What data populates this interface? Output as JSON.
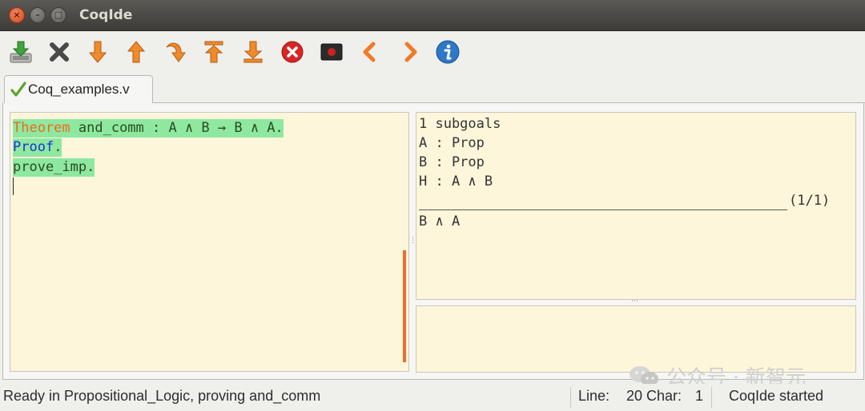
{
  "window": {
    "title": "CoqIde"
  },
  "toolbar": {
    "buttons": [
      {
        "icon": "save-icon",
        "tooltip": ""
      },
      {
        "icon": "close-icon",
        "tooltip": ""
      },
      {
        "icon": "arrow-down-icon",
        "tooltip": ""
      },
      {
        "icon": "arrow-up-icon",
        "tooltip": ""
      },
      {
        "icon": "goto-cursor-icon",
        "tooltip": ""
      },
      {
        "icon": "go-top-icon",
        "tooltip": ""
      },
      {
        "icon": "go-bottom-icon",
        "tooltip": ""
      },
      {
        "icon": "stop-icon",
        "tooltip": ""
      },
      {
        "icon": "terminal-icon",
        "tooltip": ""
      },
      {
        "icon": "chevron-left-icon",
        "tooltip": ""
      },
      {
        "icon": "chevron-right-icon",
        "tooltip": ""
      },
      {
        "icon": "info-icon",
        "tooltip": ""
      }
    ]
  },
  "tab": {
    "label": "Coq_examples.v",
    "icon": "checkmark-icon"
  },
  "editor": {
    "line1": {
      "keyword": "Theorem",
      "rest": " and_comm : A ∧ B → B ∧ A."
    },
    "line2": {
      "keyword": "Proof",
      "rest": "."
    },
    "line3": {
      "text": "prove_imp."
    }
  },
  "goals": {
    "count": "1 subgoals",
    "hypotheses": [
      "A : Prop",
      "B : Prop",
      "H : A ∧ B"
    ],
    "goal_index": "(1/1)",
    "goal": "B ∧ A"
  },
  "status": {
    "message": "Ready in Propositional_Logic, proving and_comm",
    "line_label": "Line:",
    "line_value": "20",
    "char_label": "Char:",
    "char_value": "1",
    "state": "CoqIde started"
  },
  "watermark": {
    "text": "公众号 · 新智元"
  },
  "colors": {
    "keyword": "#ef6a1a",
    "proof_keyword": "#1733d6",
    "processed_highlight": "#8ee8a0",
    "editor_bg": "#fdf6da"
  }
}
